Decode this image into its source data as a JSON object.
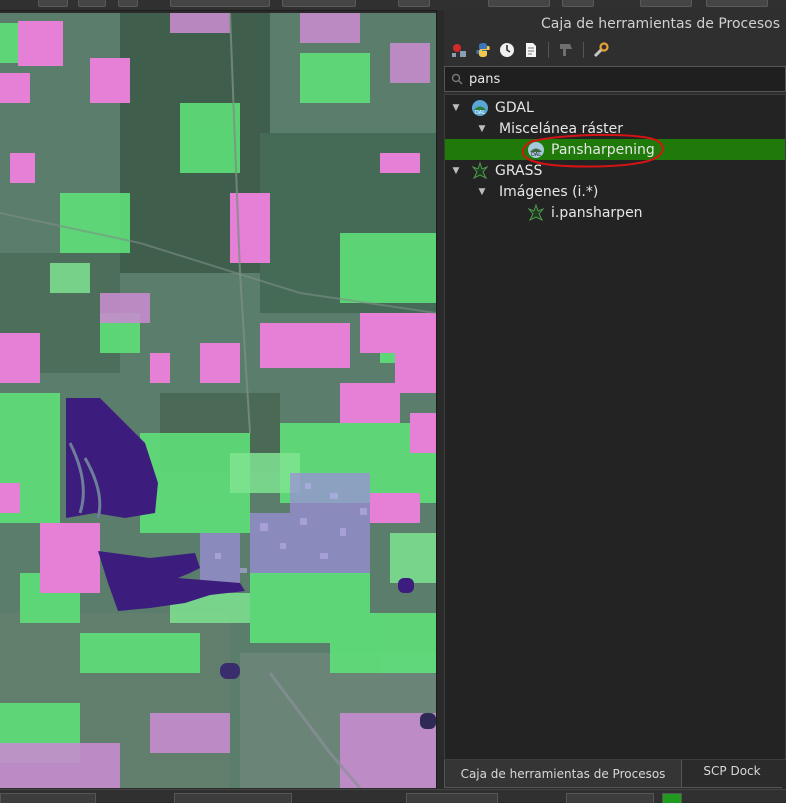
{
  "panel": {
    "title": "Caja de herramientas de Procesos",
    "toolbar": [
      {
        "icon": "models-icon"
      },
      {
        "icon": "python-icon"
      },
      {
        "icon": "history-icon"
      },
      {
        "icon": "results-icon"
      },
      {
        "icon": "edit-in-place-icon"
      },
      {
        "icon": "options-icon"
      }
    ],
    "search": {
      "value": "pans",
      "icon": "search-icon"
    }
  },
  "tree": {
    "providers": [
      {
        "label": "GDAL",
        "icon": "gdal-icon",
        "expanded": true,
        "groups": [
          {
            "label": "Miscelánea ráster",
            "expanded": true,
            "algorithms": [
              {
                "label": "Pansharpening",
                "icon": "gdal-icon",
                "selected": true
              }
            ]
          }
        ]
      },
      {
        "label": "GRASS",
        "icon": "grass-icon",
        "expanded": true,
        "groups": [
          {
            "label": "Imágenes (i.*)",
            "expanded": true,
            "algorithms": [
              {
                "label": "i.pansharpen",
                "icon": "grass-icon",
                "selected": false
              }
            ]
          }
        ]
      }
    ]
  },
  "dock_tabs": [
    {
      "label": "Caja de herramientas de Procesos",
      "active": true
    },
    {
      "label": "SCP Dock",
      "active": false
    }
  ],
  "colors": {
    "selection": "#1f7a0a",
    "annotation": "#d41414",
    "panel_bg": "#2f2f2f",
    "tree_bg": "#232323"
  }
}
